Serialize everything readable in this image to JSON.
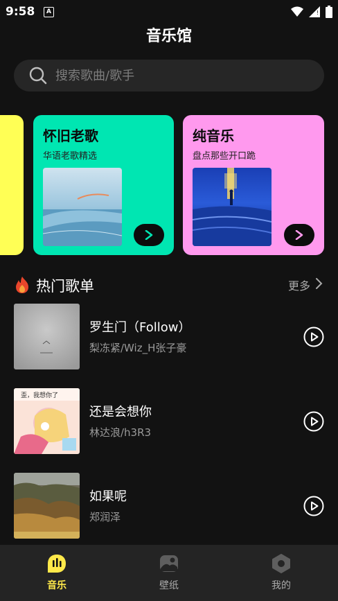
{
  "status": {
    "time": "9:58"
  },
  "header": {
    "title": "音乐馆"
  },
  "search": {
    "placeholder": "搜索歌曲/歌手"
  },
  "categories": [
    {
      "title": "怀旧老歌",
      "subtitle": "华语老歌精选",
      "color": "#00e6b2"
    },
    {
      "title": "纯音乐",
      "subtitle": "盘点那些开口跪",
      "color": "#ff99ee"
    }
  ],
  "hot": {
    "title": "热门歌单",
    "more": "更多"
  },
  "songs": [
    {
      "name": "罗生门（Follow）",
      "artist": "梨冻紧/Wiz_H张子豪"
    },
    {
      "name": "还是会想你",
      "artist": "林达浪/h3R3"
    },
    {
      "name": "如果呢",
      "artist": "郑润泽"
    }
  ],
  "tabs": [
    {
      "label": "音乐",
      "active": true
    },
    {
      "label": "壁纸",
      "active": false
    },
    {
      "label": "我的",
      "active": false
    }
  ],
  "colors": {
    "accent": "#ffe94a",
    "background": "#121212",
    "tabbar": "#242424"
  }
}
